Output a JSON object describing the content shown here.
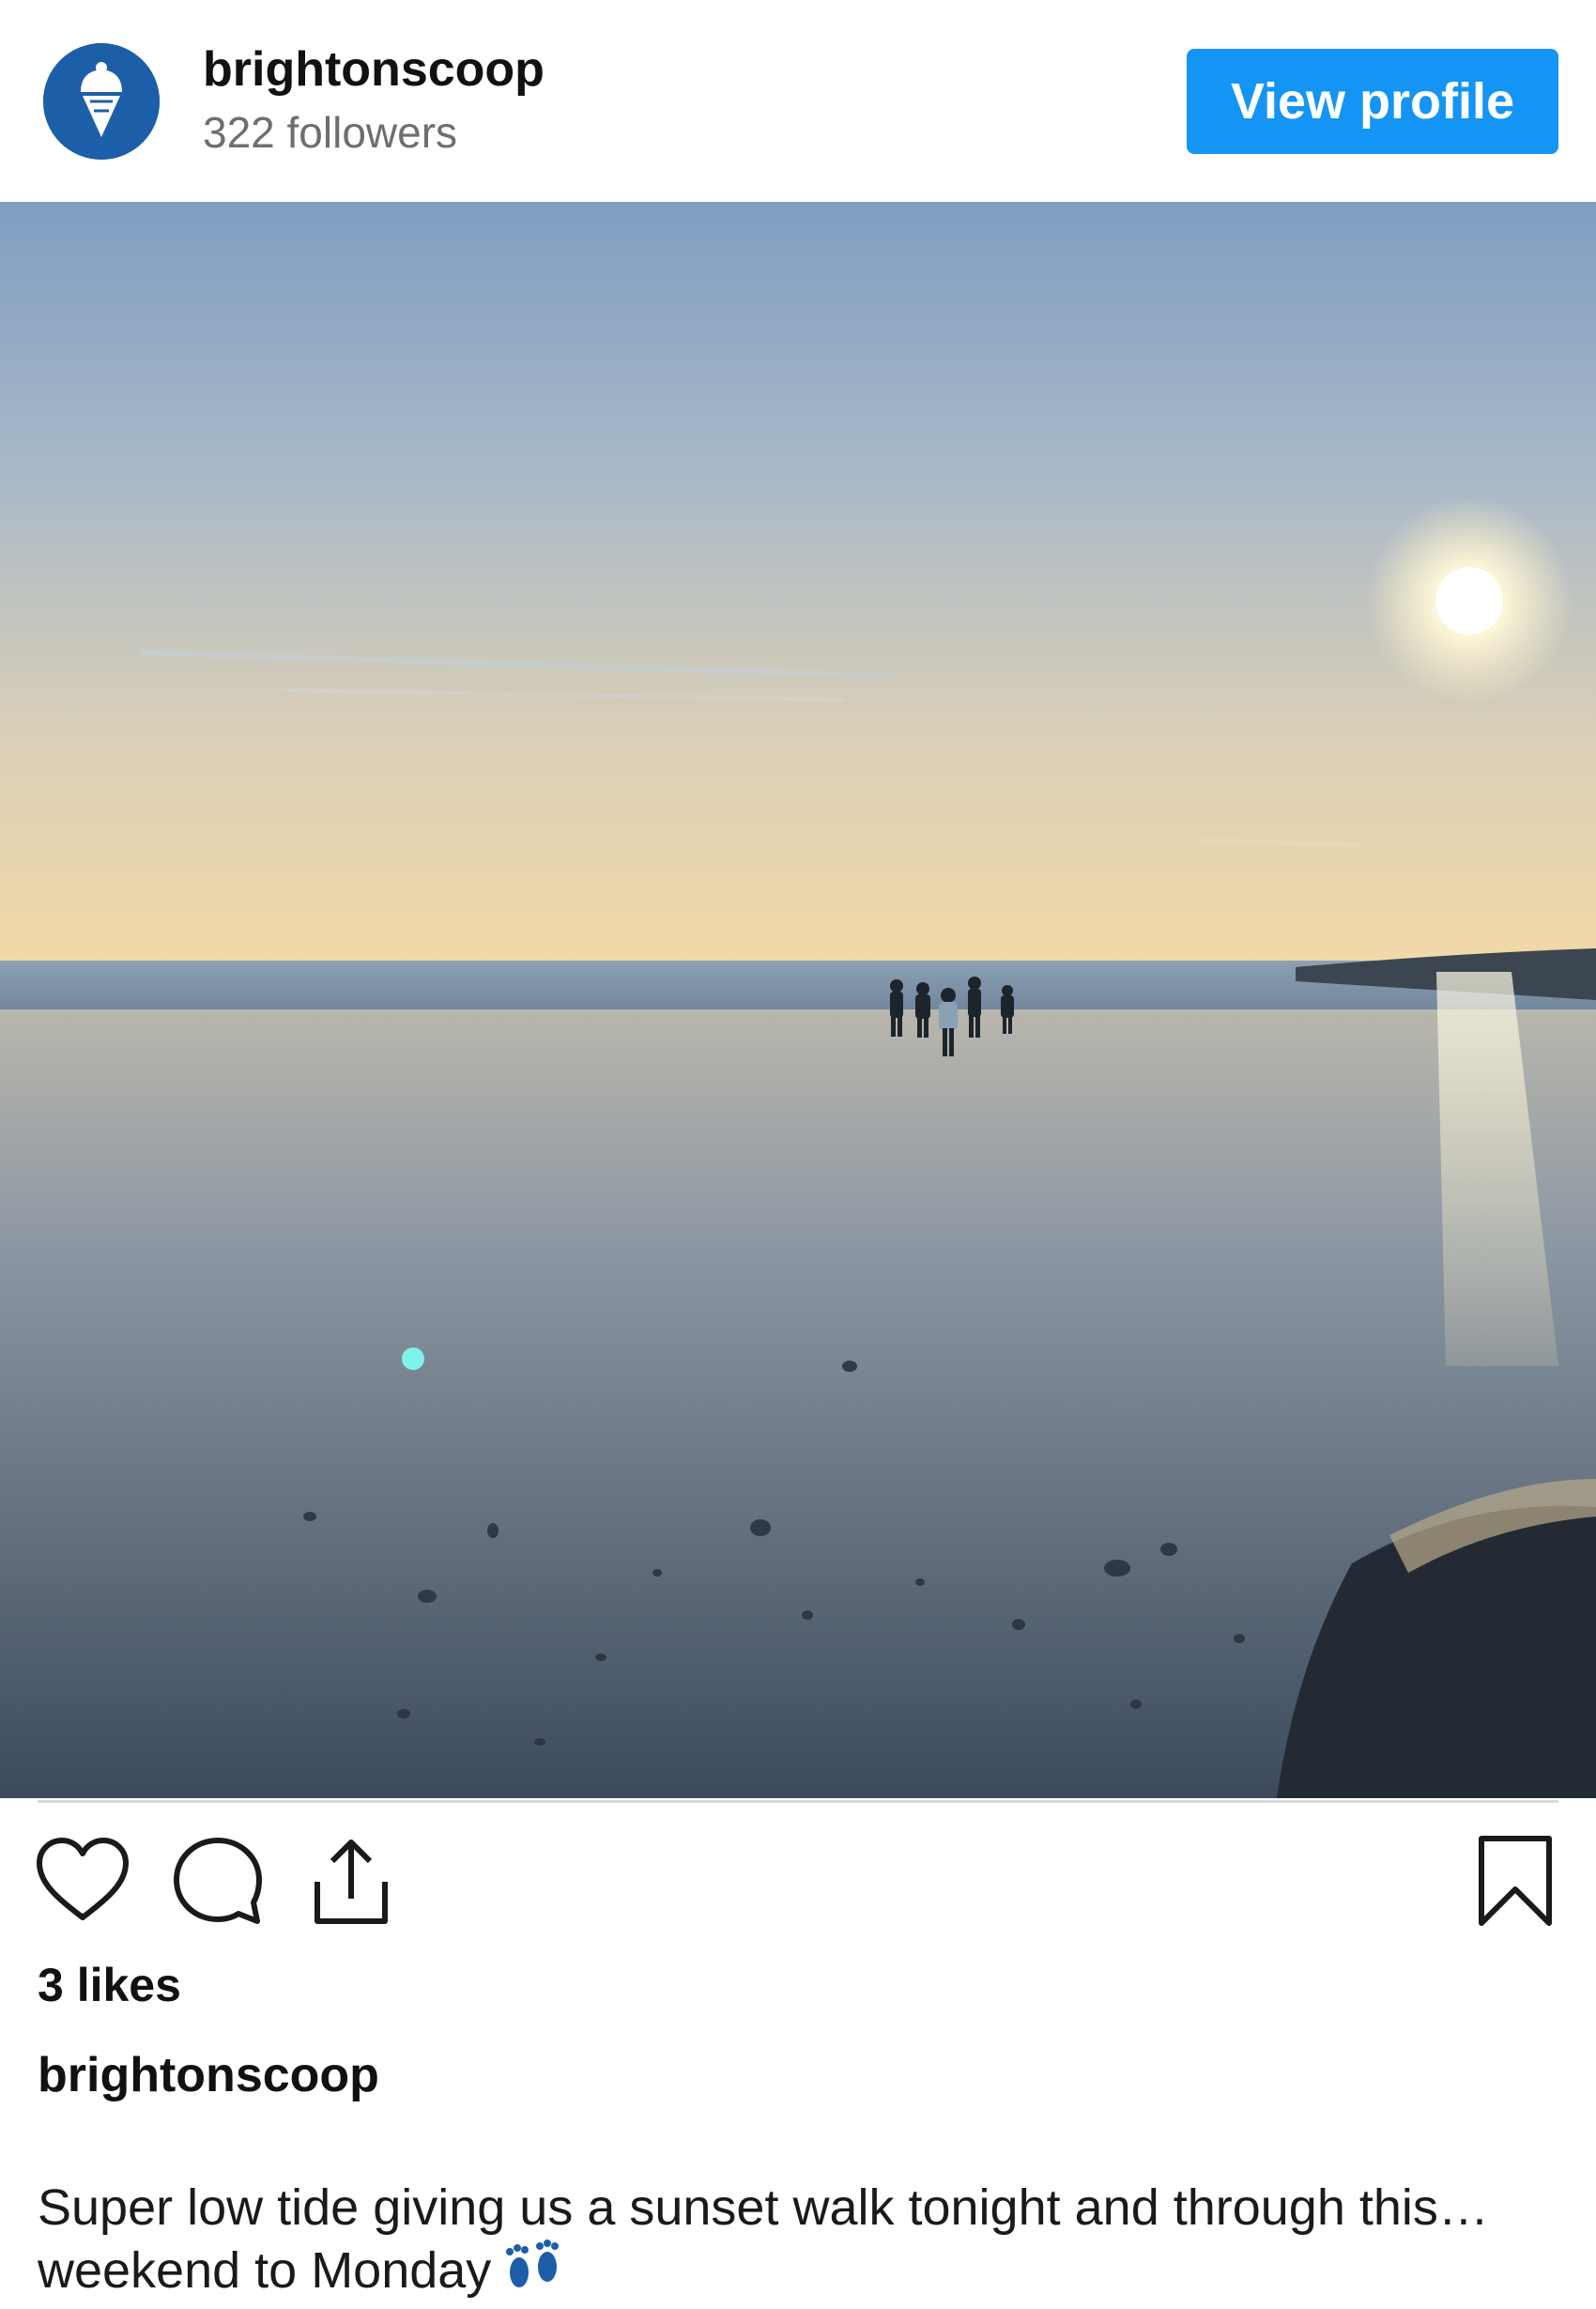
{
  "header": {
    "avatar_icon": "ice-cream-icon",
    "username": "brightonscoop",
    "followers": "322 followers",
    "view_profile_label": "View profile"
  },
  "post": {
    "image_subject": "beach-sunset-photo",
    "actions": {
      "like_icon": "heart-icon",
      "comment_icon": "comment-icon",
      "share_icon": "share-icon",
      "save_icon": "bookmark-icon"
    },
    "likes": "3 likes",
    "caption_user": "brightonscoop",
    "caption_line_1": "Super low tide giving us a sunset walk tonight and through this…",
    "caption_line_2": "weekend to Monday",
    "caption_emoji_icon": "footprints-icon"
  },
  "colors": {
    "brand_blue": "#1c5fa8",
    "button_blue": "#1495f5",
    "followers_gray": "#6e6e6e"
  }
}
